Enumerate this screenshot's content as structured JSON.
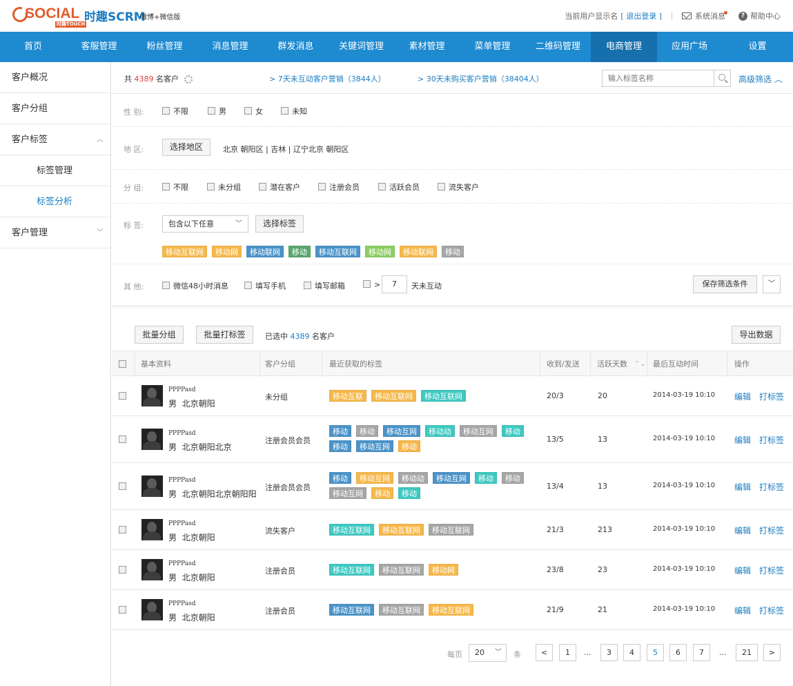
{
  "header": {
    "logo_text": "SOCIAL",
    "logo_sub": "时趣TOUCH",
    "brand_cn": "时趣SCRM",
    "brand_sub": "微博+微信版",
    "current_user": "当前用户显示名",
    "logout": "[ 退出登录 ]",
    "messages": "系统消息",
    "help": "帮助中心"
  },
  "nav": [
    "首页",
    "客服管理",
    "粉丝管理",
    "消息管理",
    "群发消息",
    "关键词管理",
    "素材管理",
    "菜单管理",
    "二维码管理",
    "电商管理",
    "应用广场",
    "设置"
  ],
  "nav_active": "电商管理",
  "sidebar": {
    "items": [
      "客户概况",
      "客户分组",
      "客户标签",
      "标签管理",
      "标签分析",
      "客户管理"
    ]
  },
  "filterbar": {
    "prefix": "共",
    "count": "4389",
    "suffix": "名客户",
    "link1": "> 7天未互动客户营销（3844人）",
    "link2": "> 30天未购买客户营销（38404人）",
    "search_placeholder": "输入标签名称",
    "advanced": "高级筛选"
  },
  "filters": {
    "gender": {
      "label": "性  别:",
      "options": [
        "不限",
        "男",
        "女",
        "未知"
      ]
    },
    "region": {
      "label": "地  区:",
      "button": "选择地区",
      "value": "北京 朝阳区 | 吉林 | 辽宁北京 朝阳区"
    },
    "group": {
      "label": "分  组:",
      "options": [
        "不限",
        "未分组",
        "潜在客户",
        "注册会员",
        "活跃会员",
        "流失客户"
      ]
    },
    "tags": {
      "label": "标  签:",
      "select": "包含以下任意",
      "button": "选择标签",
      "chips": [
        [
          "移动互联网",
          "or"
        ],
        [
          "移动网",
          "or"
        ],
        [
          "移动联网",
          "bl"
        ],
        [
          "移动",
          "gr"
        ],
        [
          "移动互联网",
          "bl"
        ],
        [
          "移动网",
          "lg"
        ],
        [
          "移动联网",
          "or"
        ],
        [
          "移动",
          "gy"
        ]
      ]
    },
    "other": {
      "label": "其  他:",
      "options": [
        "微信48小时消息",
        "填写手机",
        "填写邮箱"
      ],
      "gt": ">",
      "days": "7",
      "days_suffix": "天未互动",
      "save": "保存筛选条件"
    }
  },
  "toolbar": {
    "batch_group": "批量分组",
    "batch_tag": "批量打标签",
    "selected_prefix": "已选中",
    "selected_count": "4389",
    "selected_suffix": "名客户",
    "export": "导出数据"
  },
  "table": {
    "headers": [
      "基本资料",
      "客户分组",
      "最近获取的标签",
      "收到/发送",
      "活跃天数",
      "最后互动时间",
      "操作"
    ],
    "rows": [
      {
        "name": "PPPPasd",
        "gender": "男",
        "city": "北京朝阳",
        "group": "未分组",
        "tags": [
          [
            "移动互联",
            "or"
          ],
          [
            "移动互联网",
            "or"
          ],
          [
            "移动互联网",
            "tl"
          ]
        ],
        "rs": "20/3",
        "days": "20",
        "time": "2014-03-19 10:10"
      },
      {
        "name": "PPPPasd",
        "gender": "男",
        "city": "北京朝阳北京",
        "group": "注册会员会员",
        "tags": [
          [
            "移动",
            "bl"
          ],
          [
            "移动",
            "gy"
          ],
          [
            "移动互网",
            "bl"
          ],
          [
            "移动动",
            "tl"
          ],
          [
            "移动互网",
            "gy"
          ],
          [
            "移动",
            "tl"
          ],
          [
            "移动",
            "bl"
          ],
          [
            "移动互网",
            "bl"
          ],
          [
            "移动",
            "or"
          ]
        ],
        "rs": "13/5",
        "days": "13",
        "time": "2014-03-19 10:10"
      },
      {
        "name": "PPPPasd",
        "gender": "男",
        "city": "北京朝阳北京朝阳阳",
        "group": "注册会员会员",
        "tags": [
          [
            "移动",
            "bl"
          ],
          [
            "移动互网",
            "or"
          ],
          [
            "移动动",
            "gy"
          ],
          [
            "移动互网",
            "bl"
          ],
          [
            "移动",
            "tl"
          ],
          [
            "移动",
            "gy"
          ],
          [
            "移动互网",
            "gy"
          ],
          [
            "移动",
            "or"
          ],
          [
            "移动",
            "tl"
          ]
        ],
        "rs": "13/4",
        "days": "13",
        "time": "2014-03-19 10:10"
      },
      {
        "name": "PPPPasd",
        "gender": "男",
        "city": "北京朝阳",
        "group": "流失客户",
        "tags": [
          [
            "移动互联网",
            "tl"
          ],
          [
            "移动互联网",
            "or"
          ],
          [
            "移动互联网",
            "gy"
          ]
        ],
        "rs": "21/3",
        "days": "213",
        "time": "2014-03-19 10:10"
      },
      {
        "name": "PPPPasd",
        "gender": "男",
        "city": "北京朝阳",
        "group": "注册会员",
        "tags": [
          [
            "移动互联网",
            "tl"
          ],
          [
            "移动互联网",
            "gy"
          ],
          [
            "移动网",
            "or"
          ]
        ],
        "rs": "23/8",
        "days": "23",
        "time": "2014-03-19 10:10"
      },
      {
        "name": "PPPPasd",
        "gender": "男",
        "city": "北京朝阳",
        "group": "注册会员",
        "tags": [
          [
            "移动互联网",
            "bl"
          ],
          [
            "移动互联网",
            "gy"
          ],
          [
            "移动互联网",
            "or"
          ]
        ],
        "rs": "21/9",
        "days": "21",
        "time": "2014-03-19 10:10"
      }
    ],
    "op_edit": "编辑",
    "op_tag": "打标签"
  },
  "pager": {
    "per_page_label": "每页",
    "per_page": "20",
    "unit": "条",
    "prev": "<",
    "next": ">",
    "pages": [
      "1",
      "3",
      "4",
      "5",
      "6",
      "7",
      "21"
    ],
    "current": "5",
    "ellipsis": "..."
  }
}
